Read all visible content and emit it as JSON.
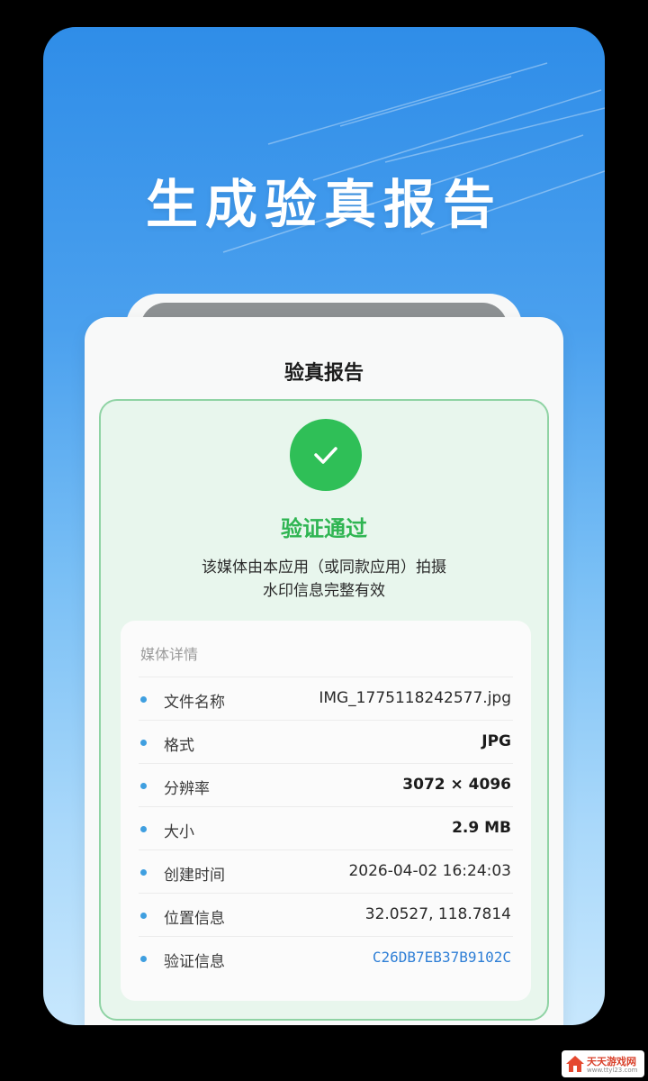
{
  "hero": {
    "title": "生成验真报告"
  },
  "card": {
    "title": "验真报告",
    "status": "验证通过",
    "description_line1": "该媒体由本应用（或同款应用）拍摄",
    "description_line2": "水印信息完整有效",
    "check_icon": "check-icon"
  },
  "details": {
    "heading": "媒体详情",
    "rows": [
      {
        "label": "文件名称",
        "value": "IMG_1775118242577.jpg"
      },
      {
        "label": "格式",
        "value": "JPG"
      },
      {
        "label": "分辨率",
        "value": "3072 × 4096"
      },
      {
        "label": "大小",
        "value": "2.9 MB"
      },
      {
        "label": "创建时间",
        "value": "2026-04-02 16:24:03"
      },
      {
        "label": "位置信息",
        "value": "32.0527, 118.7814"
      },
      {
        "label": "验证信息",
        "value": "C26DB7EB37B9102C"
      }
    ]
  },
  "watermark": {
    "text": "天天游戏网",
    "sub": "www.ttyl23.com"
  },
  "colors": {
    "accent_green": "#2fbf57",
    "link_blue": "#2f7fd6",
    "bullet_blue": "#3f9fe0"
  }
}
